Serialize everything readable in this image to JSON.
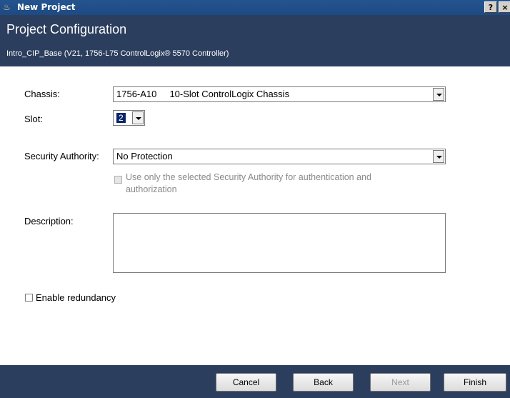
{
  "window": {
    "title": "New Project",
    "help_label": "?",
    "close_label": "×"
  },
  "header": {
    "title": "Project Configuration",
    "subtitle": "Intro_CIP_Base (V21, 1756-L75 ControlLogix® 5570 Controller)"
  },
  "form": {
    "chassis_label": "Chassis:",
    "chassis_value": "1756-A10     10-Slot ControlLogix Chassis",
    "slot_label": "Slot:",
    "slot_value": "2",
    "security_label": "Security Authority:",
    "security_value": "No Protection",
    "use_only_line1": "Use only the selected Security Authority for authentication and",
    "use_only_line2": "authorization",
    "description_label": "Description:",
    "description_value": "",
    "redundancy_label": "Enable redundancy"
  },
  "buttons": {
    "cancel": "Cancel",
    "back": "Back",
    "next": "Next",
    "finish": "Finish"
  }
}
